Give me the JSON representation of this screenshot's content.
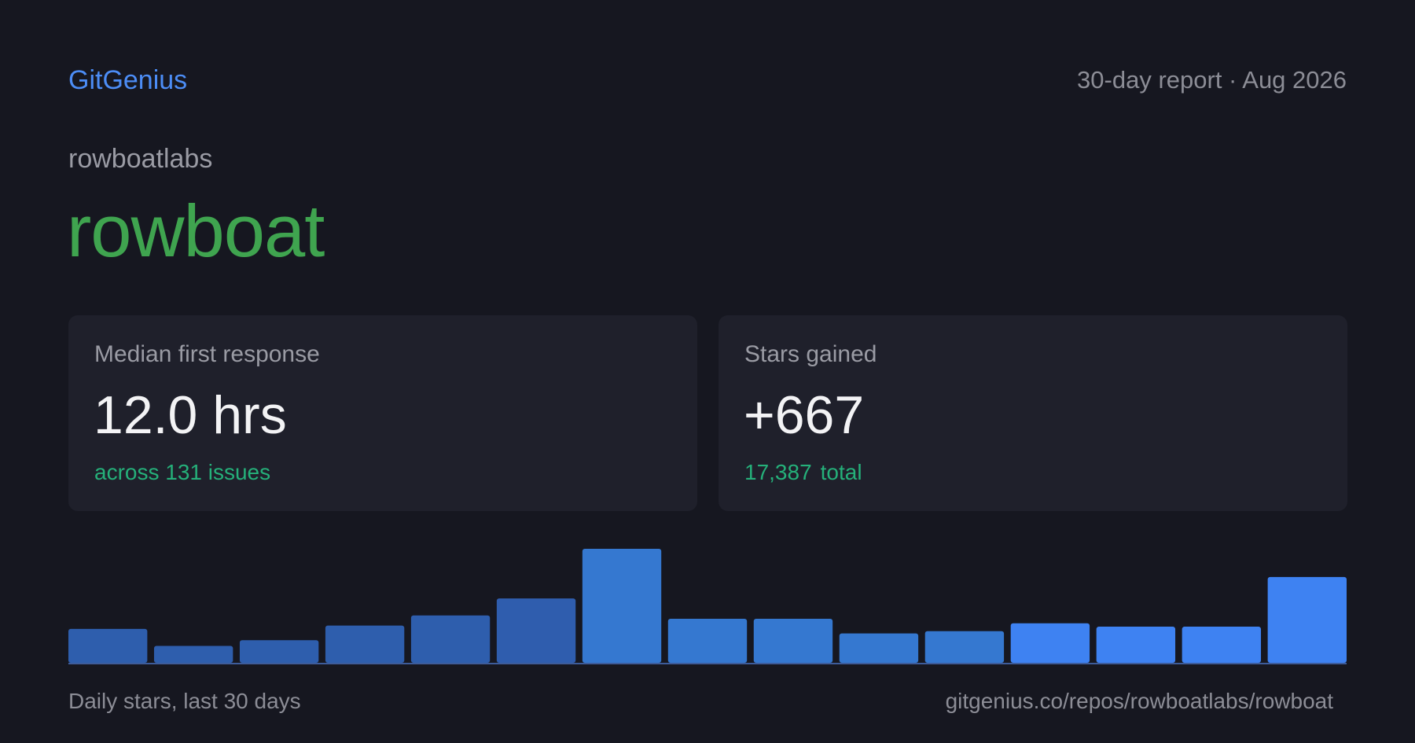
{
  "header": {
    "brand": "GitGenius",
    "report_label": "30-day report · Aug 2026"
  },
  "repository": {
    "owner": "rowboatlabs",
    "name": "rowboat"
  },
  "cards": {
    "response": {
      "label": "Median first response",
      "value": "12.0 hrs",
      "subtitle": "across 131 issues"
    },
    "stars": {
      "label": "Stars gained",
      "value": "+667",
      "subtitle_value": "17,387",
      "subtitle_suffix": "total"
    }
  },
  "footer": {
    "caption": "Daily stars, last 30 days",
    "url": "gitgenius.co/repos/rowboatlabs/rowboat"
  },
  "colors": {
    "background": "#161720",
    "card": "#1f202b",
    "brand": "#4c8df6",
    "repo": "#3fa44f",
    "accent": "#25b07a"
  },
  "chart_data": {
    "type": "bar",
    "values": [
      30,
      15,
      20,
      33,
      42,
      57,
      101,
      39,
      39,
      26,
      28,
      35,
      32,
      32,
      76
    ],
    "colors": [
      "#2e5ead",
      "#2e5ead",
      "#2e5ead",
      "#2e5ead",
      "#2e5ead",
      "#2f5dae",
      "#3578d0",
      "#3578d0",
      "#3578d0",
      "#3578d0",
      "#3578d0",
      "#3e82f2",
      "#3e82f2",
      "#3e82f2",
      "#3e82f2"
    ],
    "ylim": [
      0,
      101
    ],
    "grid": false,
    "caption": "Daily stars, last 30 days"
  }
}
